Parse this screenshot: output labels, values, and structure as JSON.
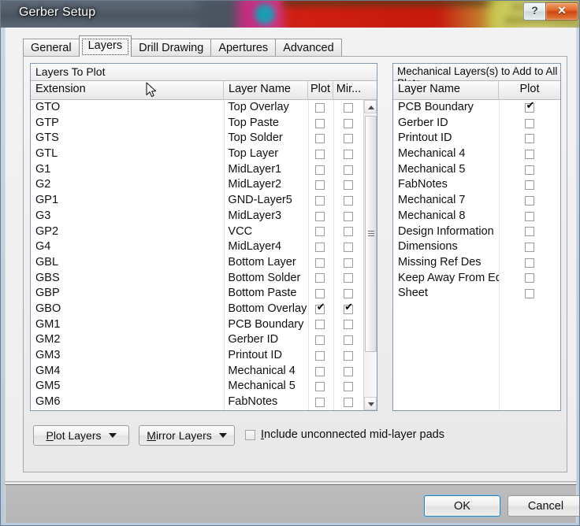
{
  "window": {
    "title": "Gerber Setup",
    "help_button": "?",
    "close_button": "✕"
  },
  "tabs": [
    {
      "label": "General",
      "active": false
    },
    {
      "label": "Layers",
      "active": true
    },
    {
      "label": "Drill Drawing",
      "active": false
    },
    {
      "label": "Apertures",
      "active": false
    },
    {
      "label": "Advanced",
      "active": false
    }
  ],
  "left_list": {
    "title": "Layers To Plot",
    "columns": [
      "Extension",
      "Layer Name",
      "Plot",
      "Mir..."
    ],
    "rows": [
      {
        "extension": "GTO",
        "layer_name": "Top Overlay",
        "plot": false,
        "mirror": false
      },
      {
        "extension": "GTP",
        "layer_name": "Top Paste",
        "plot": false,
        "mirror": false
      },
      {
        "extension": "GTS",
        "layer_name": "Top Solder",
        "plot": false,
        "mirror": false
      },
      {
        "extension": "GTL",
        "layer_name": "Top Layer",
        "plot": false,
        "mirror": false
      },
      {
        "extension": "G1",
        "layer_name": "MidLayer1",
        "plot": false,
        "mirror": false
      },
      {
        "extension": "G2",
        "layer_name": "MidLayer2",
        "plot": false,
        "mirror": false
      },
      {
        "extension": "GP1",
        "layer_name": "GND-Layer5",
        "plot": false,
        "mirror": false
      },
      {
        "extension": "G3",
        "layer_name": "MidLayer3",
        "plot": false,
        "mirror": false
      },
      {
        "extension": "GP2",
        "layer_name": "VCC",
        "plot": false,
        "mirror": false
      },
      {
        "extension": "G4",
        "layer_name": "MidLayer4",
        "plot": false,
        "mirror": false
      },
      {
        "extension": "GBL",
        "layer_name": "Bottom Layer",
        "plot": false,
        "mirror": false
      },
      {
        "extension": "GBS",
        "layer_name": "Bottom Solder",
        "plot": false,
        "mirror": false
      },
      {
        "extension": "GBP",
        "layer_name": "Bottom Paste",
        "plot": false,
        "mirror": false
      },
      {
        "extension": "GBO",
        "layer_name": "Bottom Overlay",
        "plot": true,
        "mirror": true
      },
      {
        "extension": "GM1",
        "layer_name": "PCB Boundary",
        "plot": false,
        "mirror": false
      },
      {
        "extension": "GM2",
        "layer_name": "Gerber ID",
        "plot": false,
        "mirror": false
      },
      {
        "extension": "GM3",
        "layer_name": "Printout ID",
        "plot": false,
        "mirror": false
      },
      {
        "extension": "GM4",
        "layer_name": "Mechanical 4",
        "plot": false,
        "mirror": false
      },
      {
        "extension": "GM5",
        "layer_name": "Mechanical 5",
        "plot": false,
        "mirror": false
      },
      {
        "extension": "GM6",
        "layer_name": "FabNotes",
        "plot": false,
        "mirror": false
      }
    ],
    "scrollbar": {
      "up_arrow": "▲",
      "down_arrow": "▼"
    }
  },
  "right_list": {
    "title": "Mechanical Layers(s) to Add to All Plots",
    "columns": [
      "Layer Name",
      "Plot"
    ],
    "rows": [
      {
        "layer_name": "PCB Boundary",
        "plot": true
      },
      {
        "layer_name": "Gerber ID",
        "plot": false
      },
      {
        "layer_name": "Printout ID",
        "plot": false
      },
      {
        "layer_name": "Mechanical 4",
        "plot": false
      },
      {
        "layer_name": "Mechanical 5",
        "plot": false
      },
      {
        "layer_name": "FabNotes",
        "plot": false
      },
      {
        "layer_name": "Mechanical 7",
        "plot": false
      },
      {
        "layer_name": "Mechanical 8",
        "plot": false
      },
      {
        "layer_name": "Design Information",
        "plot": false
      },
      {
        "layer_name": "Dimensions",
        "plot": false
      },
      {
        "layer_name": "Missing Ref Des",
        "plot": false
      },
      {
        "layer_name": "Keep Away From Edge",
        "plot": false
      },
      {
        "layer_name": "Sheet",
        "plot": false
      }
    ]
  },
  "controls": {
    "plot_layers_button": "Plot Layers",
    "plot_layers_accel": "P",
    "mirror_layers_button": "Mirror Layers",
    "mirror_layers_accel": "M",
    "include_checkbox_label": "nclude unconnected mid-layer pads",
    "include_checkbox_accel": "I",
    "include_checkbox_checked": false
  },
  "footer": {
    "ok_label": "OK",
    "cancel_label": "Cancel"
  },
  "colors": {
    "accent_blue": "#2f7cb8",
    "list_border": "#8399b0",
    "close_button": "#cd4410",
    "panel_bg": "#eeeeee"
  }
}
